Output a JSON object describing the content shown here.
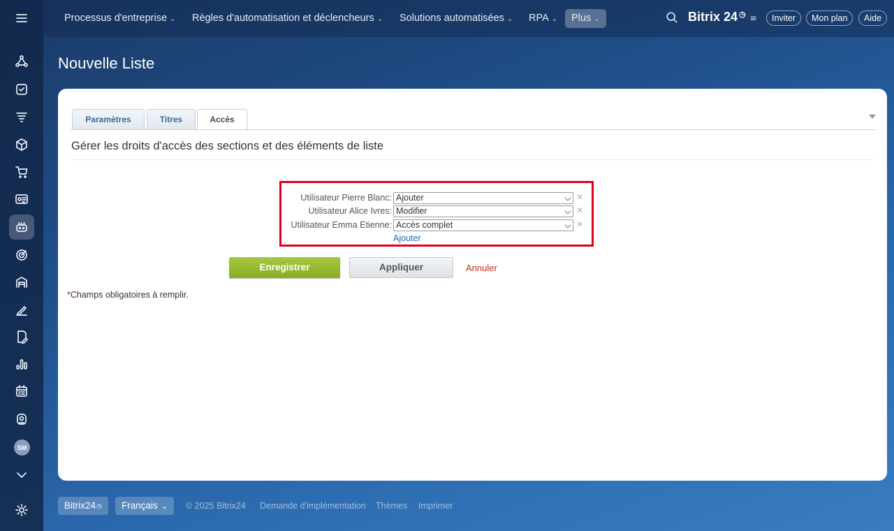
{
  "topnav": {
    "items": [
      {
        "label": "Processus d'entreprise"
      },
      {
        "label": "Règles d'automatisation et déclencheurs"
      },
      {
        "label": "Solutions automatisées"
      },
      {
        "label": "RPA"
      },
      {
        "label": "Plus"
      }
    ],
    "brand": "Bitrix 24",
    "buttons": {
      "invite": "Inviter",
      "plan": "Mon plan",
      "help": "Aide"
    }
  },
  "sidebar": {
    "icons": [
      "sitemap-icon",
      "tasks-icon",
      "funnel-icon",
      "box-icon",
      "cart-icon",
      "contact-card-icon",
      "robot-icon",
      "target-icon",
      "warehouse-icon",
      "sign-icon",
      "doc-edit-icon",
      "analytics-icon",
      "calendar-icon",
      "support-icon"
    ],
    "avatar": "SM"
  },
  "page": {
    "title": "Nouvelle Liste"
  },
  "tabs": [
    {
      "label": "Paramètres",
      "active": false
    },
    {
      "label": "Titres",
      "active": false
    },
    {
      "label": "Accès",
      "active": true
    }
  ],
  "section": {
    "title": "Gérer les droits d'accès des sections et des éléments de liste"
  },
  "permissions": [
    {
      "user": "Utilisateur Pierre Blanc:",
      "right": "Ajouter"
    },
    {
      "user": "Utilisateur Alice Ivres:",
      "right": "Modifier"
    },
    {
      "user": "Utilisateur Emma Etienne:",
      "right": "Accès complet"
    }
  ],
  "add_link": "Ajouter",
  "actions": {
    "save": "Enregistrer",
    "apply": "Appliquer",
    "cancel": "Annuler"
  },
  "required_note": {
    "star": "*",
    "text": "Champs obligatoires à remplir."
  },
  "footer": {
    "brand": "Bitrix24",
    "language": "Français",
    "copyright": "© 2025 Bitrix24",
    "links": [
      "Demande d'implémentation",
      "Thèmes",
      "Imprimer"
    ]
  },
  "colors": {
    "accent_green": "#9bbf35",
    "highlight_red": "#e0001b",
    "link_blue": "#2067b0",
    "cancel_red": "#c0301a"
  }
}
